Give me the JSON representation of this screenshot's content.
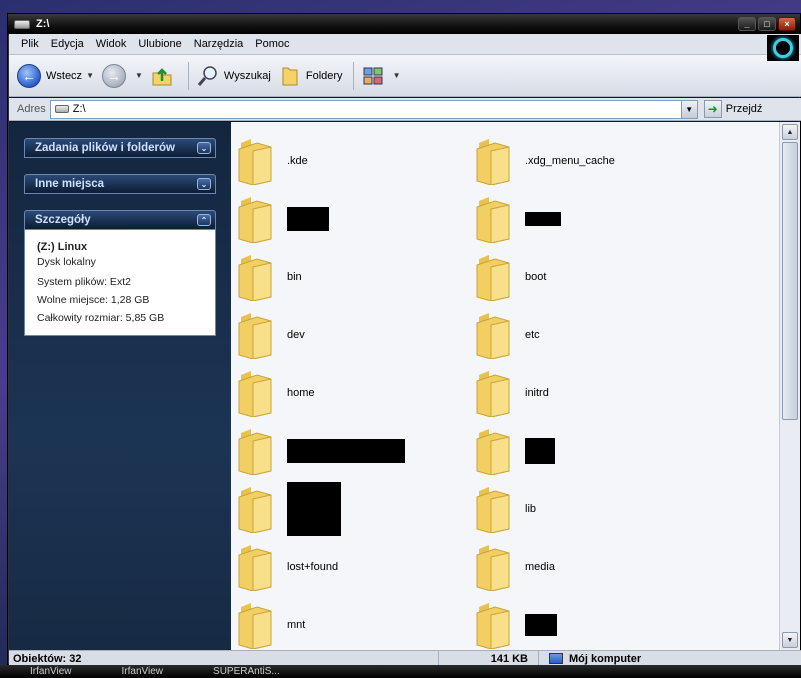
{
  "window": {
    "title": "Z:\\"
  },
  "menu": [
    "Plik",
    "Edycja",
    "Widok",
    "Ulubione",
    "Narzędzia",
    "Pomoc"
  ],
  "toolbar": {
    "back_label": "Wstecz",
    "search_label": "Wyszukaj",
    "folders_label": "Foldery"
  },
  "address": {
    "label": "Adres",
    "value": "Z:\\",
    "go_label": "Przejdź"
  },
  "tasks": {
    "file_tasks": "Zadania plików i folderów",
    "other_places": "Inne miejsca",
    "details": "Szczegóły",
    "details_title": "(Z:) Linux",
    "details_type": "Dysk lokalny",
    "filesystem": "System plików: Ext2",
    "free_space": "Wolne miejsce: 1,28 GB",
    "total_size": "Całkowity rozmiar: 5,85 GB"
  },
  "folders": [
    [
      {
        "name": ".kde"
      },
      {
        "name": ".xdg_menu_cache"
      }
    ],
    [
      {
        "name": "",
        "redact": [
          42,
          24
        ]
      },
      {
        "name": "",
        "redact": [
          36,
          14
        ]
      }
    ],
    [
      {
        "name": "bin"
      },
      {
        "name": "boot"
      }
    ],
    [
      {
        "name": "dev"
      },
      {
        "name": "etc"
      }
    ],
    [
      {
        "name": "home"
      },
      {
        "name": "initrd"
      }
    ],
    [
      {
        "name": "",
        "redact": [
          118,
          24
        ]
      },
      {
        "name": "",
        "redact": [
          30,
          26
        ]
      }
    ],
    [
      {
        "name": "",
        "redact": [
          54,
          54
        ]
      },
      {
        "name": "lib"
      }
    ],
    [
      {
        "name": "lost+found"
      },
      {
        "name": "media"
      }
    ],
    [
      {
        "name": "mnt"
      },
      {
        "name": "",
        "redact": [
          32,
          22
        ]
      }
    ]
  ],
  "status": {
    "objects": "Obiektów: 32",
    "size": "141 KB",
    "location": "Mój komputer"
  },
  "taskbar": [
    "IrfanView",
    "IrfanView",
    "SUPERAntiS..."
  ]
}
